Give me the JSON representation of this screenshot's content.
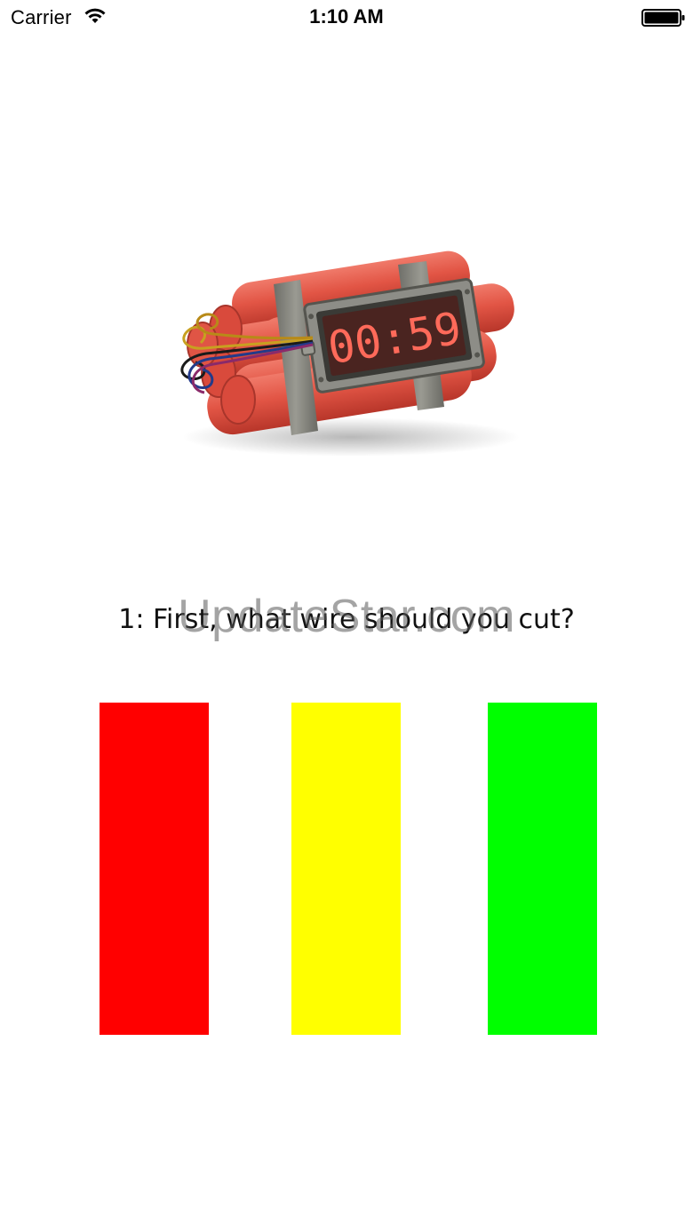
{
  "status_bar": {
    "carrier": "Carrier",
    "time": "1:10 AM",
    "wifi_icon": "wifi-icon",
    "battery_icon": "battery-icon"
  },
  "bomb": {
    "timer_display": "00:59",
    "icon": "dynamite-bomb-image"
  },
  "question": {
    "text": "1: First, what wire should you cut?"
  },
  "watermark": {
    "text": "UpdateStar.com"
  },
  "wires": [
    {
      "name": "red",
      "color": "#ff0000"
    },
    {
      "name": "yellow",
      "color": "#ffff00"
    },
    {
      "name": "green",
      "color": "#00ff00"
    }
  ]
}
